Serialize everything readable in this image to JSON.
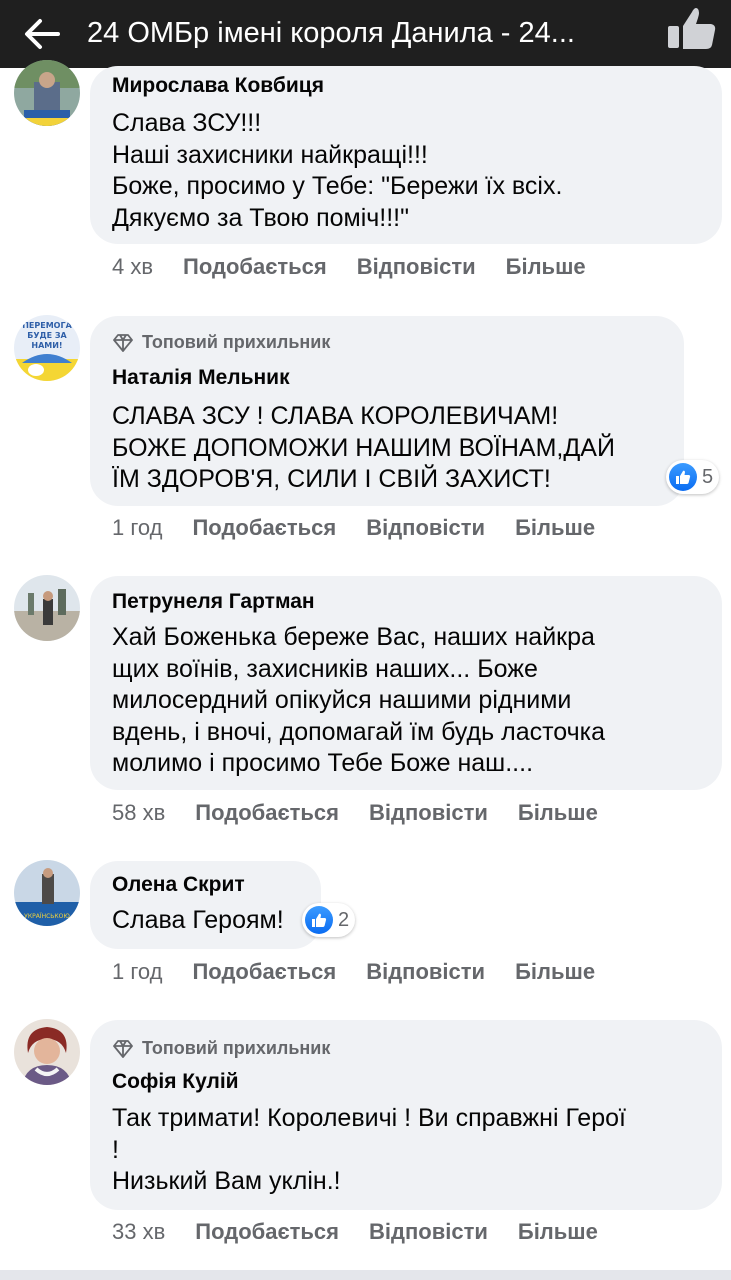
{
  "header": {
    "title": "24 ОМБр імені короля Данила - 24..."
  },
  "actions": {
    "like": "Подобається",
    "reply": "Відповісти",
    "more": "Більше"
  },
  "comments": [
    {
      "author": "Мирослава Ковбиця",
      "lines": [
        "Слава ЗСУ!!!",
        "Наші захисники найкращі!!!",
        "Боже, просимо у Тебе: \"Бережи їх всіх.",
        "Дякуємо за Твою поміч!!!\""
      ],
      "time": "4 хв"
    },
    {
      "badge": "Топовий прихильник",
      "author": "Наталія Мельник",
      "lines": [
        "СЛАВА ЗСУ ! СЛАВА КОРОЛЕВИЧАМ!",
        "БОЖЕ ДОПОМОЖИ НАШИМ ВОЇНАМ,ДАЙ",
        "ЇМ ЗДОРОВ'Я, СИЛИ І СВІЙ ЗАХИСТ!"
      ],
      "time": "1 год",
      "reactions": "5"
    },
    {
      "author": "Петрунеля Гартман",
      "lines": [
        "Хай Боженька береже Вас, наших найкра",
        "щих воїнів, захисників наших... Боже",
        "милосердний опікуйся нашими рідними",
        "вдень, і вночі, допомагай їм будь ласточка",
        "молимо і просимо Тебе Боже наш...."
      ],
      "time": "58 хв"
    },
    {
      "author": "Олена Скрит",
      "lines": [
        "Слава Героям!"
      ],
      "time": "1 год",
      "reactions": "2"
    },
    {
      "badge": "Топовий прихильник",
      "author": "Софія Кулій",
      "lines": [
        "Так тримати! Королевичі ! Ви справжні Герої",
        "!",
        "Низький Вам уклін.!"
      ],
      "time": "33 хв"
    }
  ],
  "avatars": {
    "natalia_sign": [
      "ПЕРЕМОГА",
      "БУДЕ ЗА",
      "НАМИ!"
    ],
    "olena_sign": "УКРАЇНСЬКОЮ"
  },
  "colors": {
    "header_bg": "#1f1f1f",
    "bubble_bg": "#f0f2f5",
    "meta_text": "#65676b",
    "like_blue": "#0a6cf2"
  }
}
